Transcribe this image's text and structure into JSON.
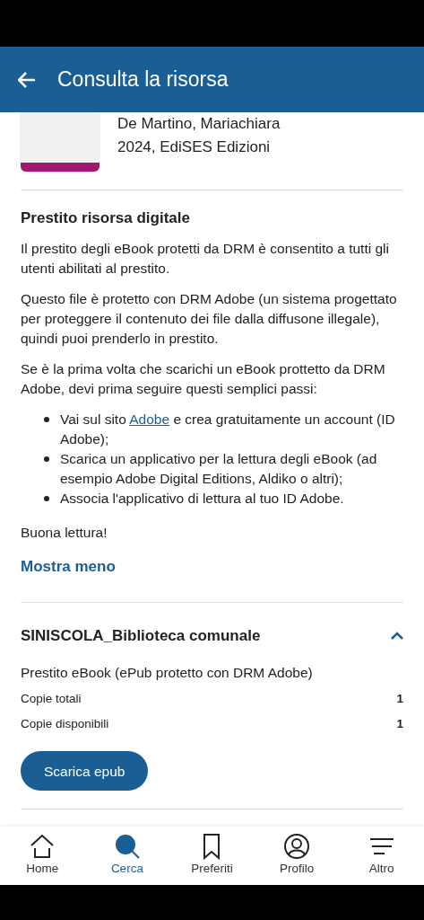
{
  "header": {
    "title": "Consulta la risorsa"
  },
  "resource": {
    "author": "De Martino, Mariachiara",
    "publication": "2024, EdiSES Edizioni"
  },
  "loan_info": {
    "title": "Prestito risorsa digitale",
    "paragraphs": [
      "Il prestito degli eBook protetti da DRM è consentito a tutti gli utenti abilitati al prestito.",
      "Questo file è protetto con DRM Adobe (un sistema progettato per proteggere il contenuto dei file dalla diffusone illegale), quindi puoi prenderlo in prestito.",
      "Se è la prima volta che scarichi un eBook prottetto da DRM Adobe, devi prima seguire questi semplici passi:"
    ],
    "steps": [
      {
        "before": "Vai sul sito ",
        "link": "Adobe",
        "after": " e crea gratuitamente un account (ID Adobe);"
      },
      {
        "before": "Scarica un applicativo per la lettura degli eBook (ad esempio Adobe Digital Editions, Aldiko o altri);"
      },
      {
        "before": "Associa l'applicativo di lettura al tuo ID Adobe."
      }
    ],
    "closing": "Buona lettura!",
    "toggle": "Mostra meno"
  },
  "library": {
    "name": "SINISCOLA_Biblioteca comunale",
    "expanded": true,
    "format": "Prestito eBook (ePub protetto con DRM Adobe)",
    "stats": [
      {
        "label": "Copie totali",
        "value": "1"
      },
      {
        "label": "Copie disponibili",
        "value": "1"
      }
    ],
    "button": "Scarica epub"
  },
  "nav": [
    {
      "kind": "home",
      "label": "Home",
      "selected": false
    },
    {
      "kind": "search",
      "label": "Cerca",
      "selected": true
    },
    {
      "kind": "bookmark",
      "label": "Preferiti",
      "selected": false
    },
    {
      "kind": "profile",
      "label": "Profilo",
      "selected": false
    },
    {
      "kind": "menu",
      "label": "Altro",
      "selected": false
    }
  ]
}
